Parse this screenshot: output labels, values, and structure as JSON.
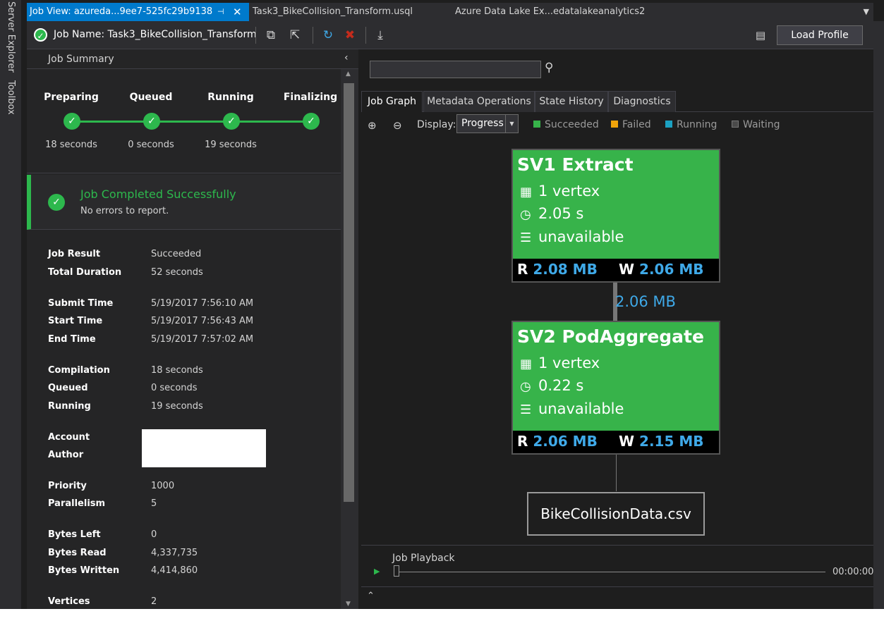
{
  "side_tabs": {
    "server_explorer": "Server Explorer",
    "toolbox": "Toolbox"
  },
  "doc_tabs": {
    "active": "Job View: azureda...9ee7-525fc29b9138",
    "usql": "Task3_BikeCollision_Transform.usql",
    "adla": "Azure Data Lake Ex...edatalakeanalytics2"
  },
  "toolbar": {
    "job_name": "Job Name: Task3_BikeCollision_Transform",
    "load_profile": "Load Profile"
  },
  "summary": {
    "title": "Job Summary",
    "stages": [
      {
        "name": "Preparing",
        "time": "18 seconds"
      },
      {
        "name": "Queued",
        "time": "0 seconds"
      },
      {
        "name": "Running",
        "time": "19 seconds"
      },
      {
        "name": "Finalizing",
        "time": ""
      }
    ],
    "status_title": "Job Completed Successfully",
    "status_sub": "No errors to report.",
    "details": [
      {
        "label": "Job Result",
        "value": "Succeeded"
      },
      {
        "label": "Total Duration",
        "value": "52 seconds"
      },
      {
        "label": "Submit Time",
        "value": "5/19/2017 7:56:10 AM"
      },
      {
        "label": "Start Time",
        "value": "5/19/2017 7:56:43 AM"
      },
      {
        "label": "End Time",
        "value": "5/19/2017 7:57:02 AM"
      },
      {
        "label": "Compilation",
        "value": "18 seconds"
      },
      {
        "label": "Queued",
        "value": "0 seconds"
      },
      {
        "label": "Running",
        "value": "19 seconds"
      },
      {
        "label": "Account",
        "value": ""
      },
      {
        "label": "Author",
        "value": ""
      },
      {
        "label": "Priority",
        "value": "1000"
      },
      {
        "label": "Parallelism",
        "value": "5"
      },
      {
        "label": "Bytes Left",
        "value": "0"
      },
      {
        "label": "Bytes Read",
        "value": "4,337,735"
      },
      {
        "label": "Bytes Written",
        "value": "4,414,860"
      },
      {
        "label": "Vertices",
        "value": "2"
      }
    ]
  },
  "graph": {
    "tabs": [
      "Job Graph",
      "Metadata Operations",
      "State History",
      "Diagnostics"
    ],
    "display_label": "Display:",
    "display_value": "Progress",
    "legend": [
      {
        "label": "Succeeded",
        "color": "#37b34a"
      },
      {
        "label": "Failed",
        "color": "#f0a30a"
      },
      {
        "label": "Running",
        "color": "#1ba1c2"
      },
      {
        "label": "Waiting",
        "color": "#4a4a4a"
      }
    ],
    "vertices": [
      {
        "title": "SV1 Extract",
        "count": "1 vertex",
        "time": "2.05 s",
        "rows": "unavailable",
        "read": "2.08 MB",
        "write": "2.06 MB"
      },
      {
        "title": "SV2 PodAggregate",
        "count": "1 vertex",
        "time": "0.22 s",
        "rows": "unavailable",
        "read": "2.06 MB",
        "write": "2.15 MB"
      }
    ],
    "edge_label": "2.06 MB",
    "output": "BikeCollisionData.csv",
    "read_prefix": "R",
    "write_prefix": "W"
  },
  "playback": {
    "label": "Job Playback",
    "time": "00:00:00"
  },
  "colors": {
    "accent": "#007acc",
    "success": "#2db84d",
    "link": "#3fa9e8"
  }
}
